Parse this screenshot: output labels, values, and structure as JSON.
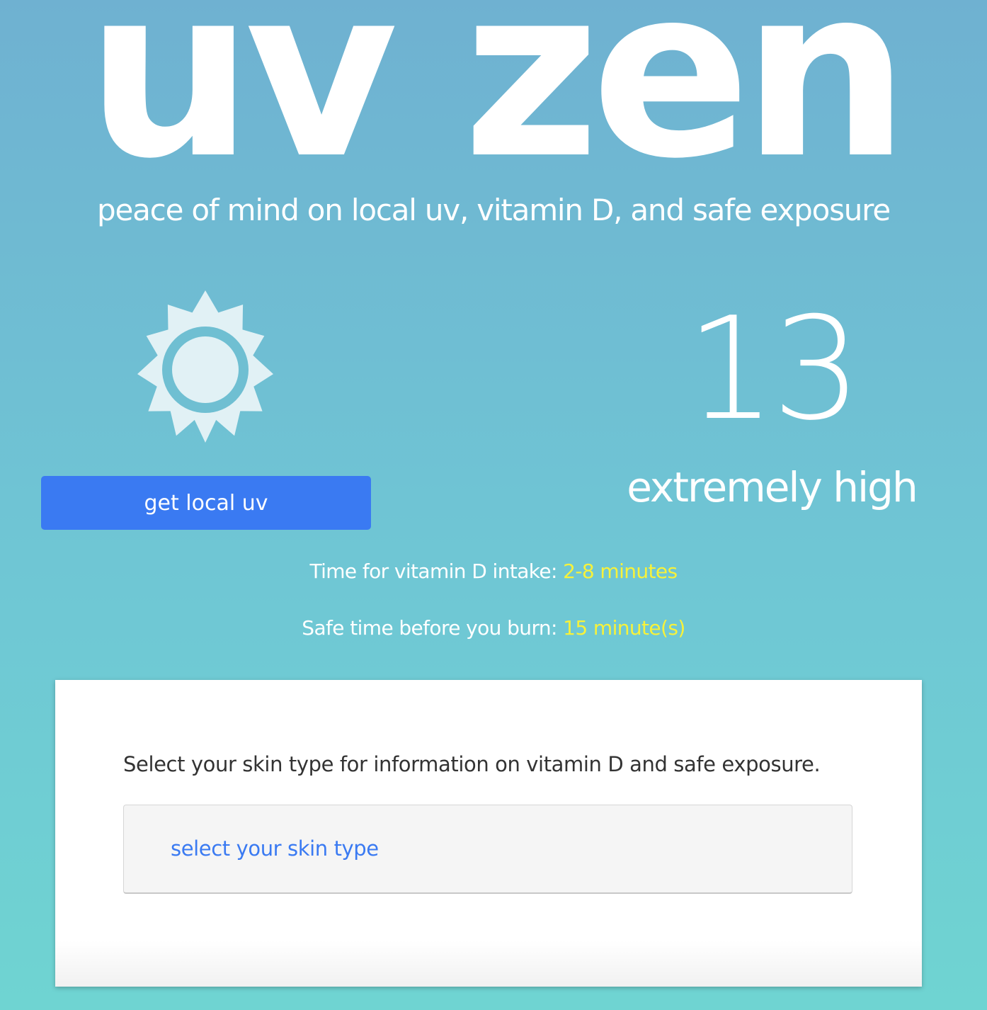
{
  "header": {
    "logo_text": "uv zen",
    "tagline": "peace of mind on local uv, vitamin D, and safe exposure"
  },
  "uv": {
    "icon": "sun-icon",
    "button_label": "get local uv",
    "index_value": "13",
    "index_label": "extremely high"
  },
  "exposure": {
    "vitamin_d_label": "Time for vitamin D intake:",
    "vitamin_d_value": "2-8 minutes",
    "burn_label": "Safe time before you burn:",
    "burn_value": "15 minute(s)"
  },
  "skin_card": {
    "instruction": "Select your skin type for information on vitamin D and safe exposure.",
    "select_placeholder": "select your skin type"
  },
  "colors": {
    "background_top": "#6fb1d1",
    "background_bottom": "#6fd4d2",
    "button": "#3a7af2",
    "highlight_value": "#f7f23a",
    "select_text": "#3a7af2",
    "sun_fill": "#e1f1f5"
  }
}
